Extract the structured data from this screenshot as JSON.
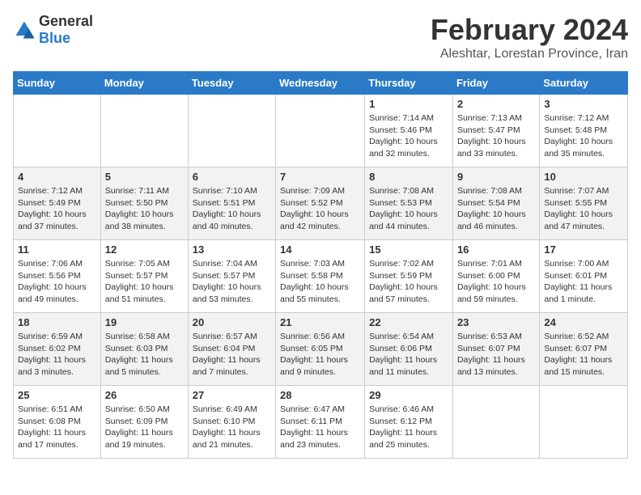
{
  "header": {
    "logo_general": "General",
    "logo_blue": "Blue",
    "title": "February 2024",
    "subtitle": "Aleshtar, Lorestan Province, Iran"
  },
  "calendar": {
    "days_of_week": [
      "Sunday",
      "Monday",
      "Tuesday",
      "Wednesday",
      "Thursday",
      "Friday",
      "Saturday"
    ],
    "weeks": [
      [
        {
          "day": "",
          "info": ""
        },
        {
          "day": "",
          "info": ""
        },
        {
          "day": "",
          "info": ""
        },
        {
          "day": "",
          "info": ""
        },
        {
          "day": "1",
          "info": "Sunrise: 7:14 AM\nSunset: 5:46 PM\nDaylight: 10 hours\nand 32 minutes."
        },
        {
          "day": "2",
          "info": "Sunrise: 7:13 AM\nSunset: 5:47 PM\nDaylight: 10 hours\nand 33 minutes."
        },
        {
          "day": "3",
          "info": "Sunrise: 7:12 AM\nSunset: 5:48 PM\nDaylight: 10 hours\nand 35 minutes."
        }
      ],
      [
        {
          "day": "4",
          "info": "Sunrise: 7:12 AM\nSunset: 5:49 PM\nDaylight: 10 hours\nand 37 minutes."
        },
        {
          "day": "5",
          "info": "Sunrise: 7:11 AM\nSunset: 5:50 PM\nDaylight: 10 hours\nand 38 minutes."
        },
        {
          "day": "6",
          "info": "Sunrise: 7:10 AM\nSunset: 5:51 PM\nDaylight: 10 hours\nand 40 minutes."
        },
        {
          "day": "7",
          "info": "Sunrise: 7:09 AM\nSunset: 5:52 PM\nDaylight: 10 hours\nand 42 minutes."
        },
        {
          "day": "8",
          "info": "Sunrise: 7:08 AM\nSunset: 5:53 PM\nDaylight: 10 hours\nand 44 minutes."
        },
        {
          "day": "9",
          "info": "Sunrise: 7:08 AM\nSunset: 5:54 PM\nDaylight: 10 hours\nand 46 minutes."
        },
        {
          "day": "10",
          "info": "Sunrise: 7:07 AM\nSunset: 5:55 PM\nDaylight: 10 hours\nand 47 minutes."
        }
      ],
      [
        {
          "day": "11",
          "info": "Sunrise: 7:06 AM\nSunset: 5:56 PM\nDaylight: 10 hours\nand 49 minutes."
        },
        {
          "day": "12",
          "info": "Sunrise: 7:05 AM\nSunset: 5:57 PM\nDaylight: 10 hours\nand 51 minutes."
        },
        {
          "day": "13",
          "info": "Sunrise: 7:04 AM\nSunset: 5:57 PM\nDaylight: 10 hours\nand 53 minutes."
        },
        {
          "day": "14",
          "info": "Sunrise: 7:03 AM\nSunset: 5:58 PM\nDaylight: 10 hours\nand 55 minutes."
        },
        {
          "day": "15",
          "info": "Sunrise: 7:02 AM\nSunset: 5:59 PM\nDaylight: 10 hours\nand 57 minutes."
        },
        {
          "day": "16",
          "info": "Sunrise: 7:01 AM\nSunset: 6:00 PM\nDaylight: 10 hours\nand 59 minutes."
        },
        {
          "day": "17",
          "info": "Sunrise: 7:00 AM\nSunset: 6:01 PM\nDaylight: 11 hours\nand 1 minute."
        }
      ],
      [
        {
          "day": "18",
          "info": "Sunrise: 6:59 AM\nSunset: 6:02 PM\nDaylight: 11 hours\nand 3 minutes."
        },
        {
          "day": "19",
          "info": "Sunrise: 6:58 AM\nSunset: 6:03 PM\nDaylight: 11 hours\nand 5 minutes."
        },
        {
          "day": "20",
          "info": "Sunrise: 6:57 AM\nSunset: 6:04 PM\nDaylight: 11 hours\nand 7 minutes."
        },
        {
          "day": "21",
          "info": "Sunrise: 6:56 AM\nSunset: 6:05 PM\nDaylight: 11 hours\nand 9 minutes."
        },
        {
          "day": "22",
          "info": "Sunrise: 6:54 AM\nSunset: 6:06 PM\nDaylight: 11 hours\nand 11 minutes."
        },
        {
          "day": "23",
          "info": "Sunrise: 6:53 AM\nSunset: 6:07 PM\nDaylight: 11 hours\nand 13 minutes."
        },
        {
          "day": "24",
          "info": "Sunrise: 6:52 AM\nSunset: 6:07 PM\nDaylight: 11 hours\nand 15 minutes."
        }
      ],
      [
        {
          "day": "25",
          "info": "Sunrise: 6:51 AM\nSunset: 6:08 PM\nDaylight: 11 hours\nand 17 minutes."
        },
        {
          "day": "26",
          "info": "Sunrise: 6:50 AM\nSunset: 6:09 PM\nDaylight: 11 hours\nand 19 minutes."
        },
        {
          "day": "27",
          "info": "Sunrise: 6:49 AM\nSunset: 6:10 PM\nDaylight: 11 hours\nand 21 minutes."
        },
        {
          "day": "28",
          "info": "Sunrise: 6:47 AM\nSunset: 6:11 PM\nDaylight: 11 hours\nand 23 minutes."
        },
        {
          "day": "29",
          "info": "Sunrise: 6:46 AM\nSunset: 6:12 PM\nDaylight: 11 hours\nand 25 minutes."
        },
        {
          "day": "",
          "info": ""
        },
        {
          "day": "",
          "info": ""
        }
      ]
    ]
  }
}
